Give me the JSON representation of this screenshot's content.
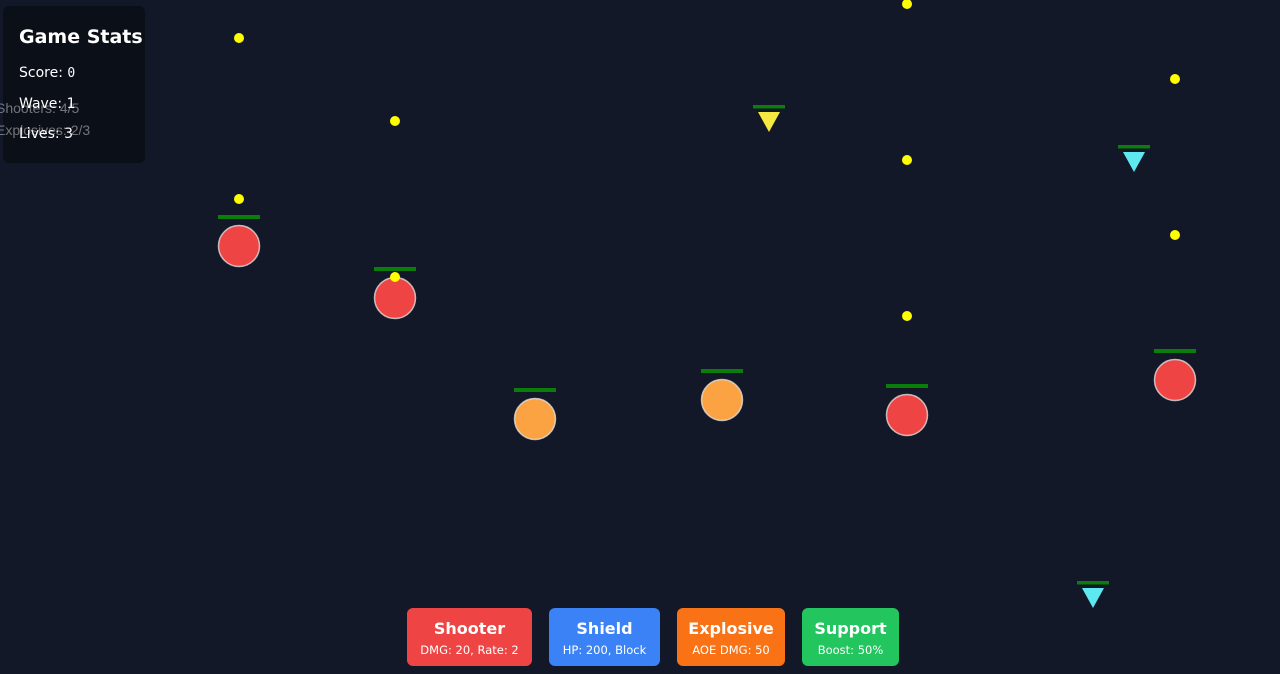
{
  "stats": {
    "title": "Game Stats",
    "score_label": "Score: ",
    "score": "0",
    "wave_label": "Wave: ",
    "wave": "1",
    "lives_label": "Lives: ",
    "lives": "3"
  },
  "counters": {
    "shooters": "Shooters: 4/5",
    "explosives": "Explosives: 2/3"
  },
  "units": [
    {
      "name": "Shooter",
      "desc": "DMG: 20, Rate: 2",
      "color": "#ef4444"
    },
    {
      "name": "Shield",
      "desc": "HP: 200, Block",
      "color": "#3b82f6"
    },
    {
      "name": "Explosive",
      "desc": "AOE DMG: 50",
      "color": "#f97316"
    },
    {
      "name": "Support",
      "desc": "Boost: 50%",
      "color": "#22c55e"
    }
  ],
  "colors": {
    "background": "#121828",
    "shooter_unit": "#ef4444",
    "explosive_unit": "#fba243",
    "health_bar": "#0a7d0a",
    "projectile": "#ffff00",
    "enemy_cyan": "#5ee8f0",
    "enemy_yellow": "#f5e840"
  },
  "entities": {
    "defenders": [
      {
        "type": "shooter"
      },
      {
        "type": "shooter"
      },
      {
        "type": "explosive"
      },
      {
        "type": "explosive"
      },
      {
        "type": "shooter"
      },
      {
        "type": "shooter"
      }
    ],
    "enemies": [
      {
        "type": "yellow"
      },
      {
        "type": "cyan"
      },
      {
        "type": "cyan"
      }
    ]
  }
}
